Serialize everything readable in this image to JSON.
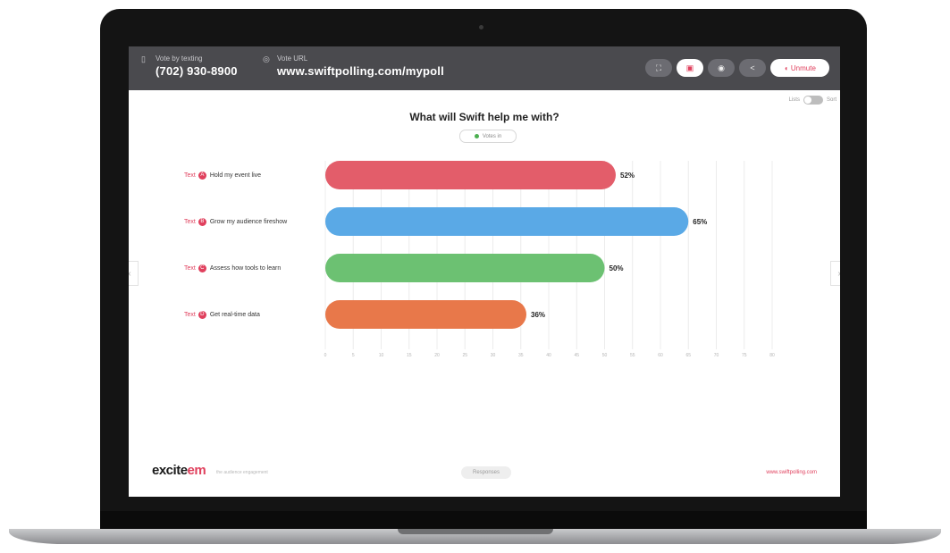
{
  "header": {
    "text_label": "Vote by texting",
    "phone": "(702) 930-8900",
    "web_label": "Vote URL",
    "url": "www.swiftpolling.com/mypoll",
    "controls": [
      "⛶",
      "▣",
      "◉",
      "<",
      "Unmute"
    ]
  },
  "poll": {
    "title": "What will Swift help me with?",
    "status": "Votes in",
    "toggle_left": "Lists",
    "toggle_right": "Sort",
    "key_prefix": "Text"
  },
  "chart_data": {
    "type": "bar",
    "orientation": "horizontal",
    "categories": [
      "Hold my event live",
      "Grow my audience fireshow",
      "Assess how tools to learn",
      "Get real-time data"
    ],
    "codes": [
      "A",
      "B",
      "C",
      "D"
    ],
    "values": [
      52,
      65,
      50,
      36
    ],
    "value_labels": [
      "52%",
      "65%",
      "50%",
      "36%"
    ],
    "colors": [
      "#e35d6a",
      "#5aa9e6",
      "#6cc172",
      "#e8784a"
    ],
    "xlim": [
      0,
      80
    ],
    "xticks": [
      0,
      5,
      10,
      15,
      20,
      25,
      30,
      35,
      40,
      45,
      50,
      55,
      60,
      65,
      70,
      75,
      80
    ],
    "legend": "none",
    "grid": true
  },
  "footer": {
    "logo_a": "excite",
    "logo_b": "em",
    "tagline": "the audience engagement",
    "responses": "Responses",
    "website": "www.swiftpolling.com"
  }
}
